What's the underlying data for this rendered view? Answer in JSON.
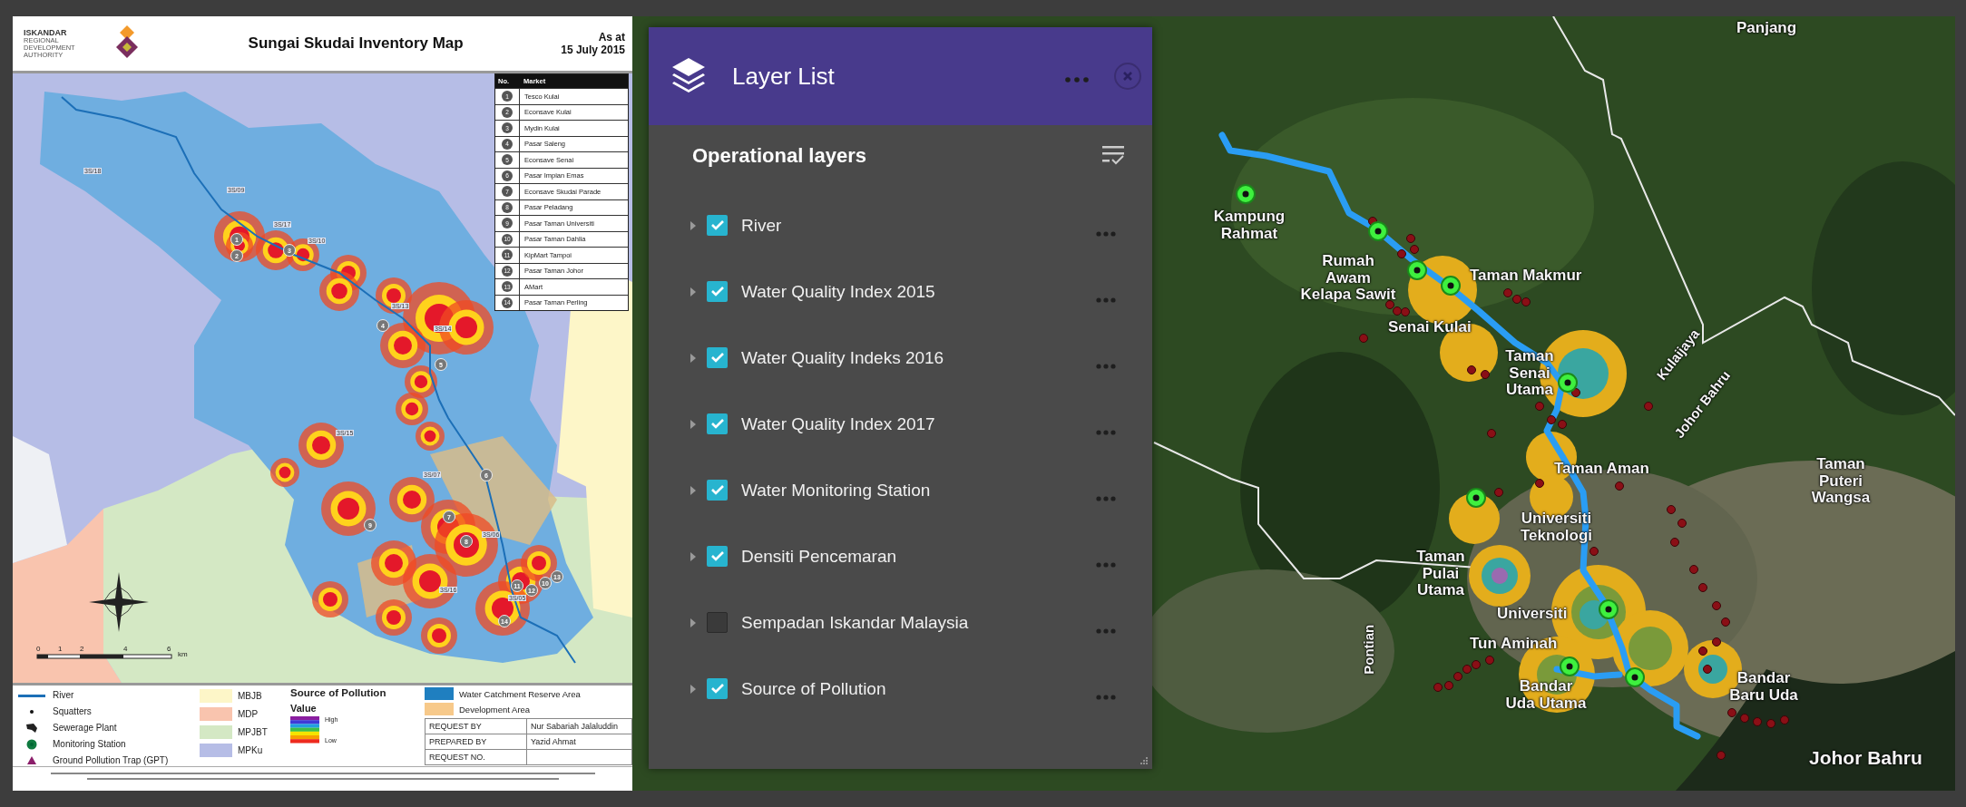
{
  "poster": {
    "logo": {
      "brand": "ISKANDAR",
      "subtitle": "REGIONAL DEVELOPMENT AUTHORITY"
    },
    "title": "Sungai Skudai Inventory Map",
    "date_lines": [
      "As at",
      "15 July 2015"
    ],
    "market_table": {
      "columns": [
        "No.",
        "Market"
      ],
      "rows": [
        {
          "no": "1",
          "market": "Tesco Kulai"
        },
        {
          "no": "2",
          "market": "Econsave Kulai"
        },
        {
          "no": "3",
          "market": "Mydin Kulai"
        },
        {
          "no": "4",
          "market": "Pasar Saleng"
        },
        {
          "no": "5",
          "market": "Econsave Senai"
        },
        {
          "no": "6",
          "market": "Pasar Impian Emas"
        },
        {
          "no": "7",
          "market": "Econsave Skudai Parade"
        },
        {
          "no": "8",
          "market": "Pasar Peladang"
        },
        {
          "no": "9",
          "market": "Pasar Taman Universiti"
        },
        {
          "no": "10",
          "market": "Pasar Taman Dahlia"
        },
        {
          "no": "11",
          "market": "KipMart Tampoi"
        },
        {
          "no": "12",
          "market": "Pasar Taman Johor"
        },
        {
          "no": "13",
          "market": "AMart"
        },
        {
          "no": "14",
          "market": "Pasar Taman Perling"
        }
      ]
    },
    "station_labels": [
      "3S/18",
      "3S/09",
      "3S/17",
      "3S/10",
      "3S/13",
      "3S/14",
      "3S/15",
      "3S/07",
      "3S/06",
      "3S/05",
      "3S/16"
    ],
    "market_markers": [
      "1",
      "2",
      "3",
      "4",
      "5",
      "6",
      "7",
      "8",
      "9",
      "10",
      "11",
      "12",
      "13",
      "14"
    ],
    "scale": {
      "ticks": [
        "0",
        "1",
        "2",
        "4",
        "6"
      ],
      "unit": "km"
    },
    "legend": {
      "symbols": [
        {
          "kind": "line",
          "label": "River"
        },
        {
          "kind": "dot",
          "label": "Squatters"
        },
        {
          "kind": "plant",
          "label": "Sewerage Plant"
        },
        {
          "kind": "station",
          "label": "Monitoring Station"
        },
        {
          "kind": "triangle",
          "label": "Ground Pollution Trap (GPT)"
        }
      ],
      "areas": [
        {
          "label": "MBJB",
          "color": "#fdf6c8"
        },
        {
          "label": "MDP",
          "color": "#f9c4ae"
        },
        {
          "label": "MPJBT",
          "color": "#d4e8c4"
        },
        {
          "label": "MPKu",
          "color": "#b6bde6"
        }
      ],
      "pollution": {
        "title": "Source of Pollution",
        "subtitle": "Value",
        "high": "High",
        "low": "Low"
      },
      "zones": [
        {
          "label": "Water Catchment Reserve Area",
          "color": "#1f7fc0"
        },
        {
          "label": "Development Area",
          "color": "#f7c98a"
        }
      ],
      "request": [
        {
          "label": "REQUEST BY",
          "value": "Nur Sabariah Jalaluddin"
        },
        {
          "label": "PREPARED BY",
          "value": "Yazid Ahmat"
        },
        {
          "label": "REQUEST NO."
        }
      ]
    }
  },
  "layer_list": {
    "title": "Layer List",
    "section": "Operational layers",
    "layers": [
      {
        "name": "River",
        "checked": true
      },
      {
        "name": "Water Quality Index 2015",
        "checked": true
      },
      {
        "name": "Water Quality Indeks 2016",
        "checked": true
      },
      {
        "name": "Water Quality Index 2017",
        "checked": true
      },
      {
        "name": "Water Monitoring Station",
        "checked": true
      },
      {
        "name": "Densiti Pencemaran",
        "checked": true
      },
      {
        "name": "Sempadan Iskandar Malaysia",
        "checked": false
      },
      {
        "name": "Source of Pollution",
        "checked": true
      }
    ]
  },
  "map": {
    "labels": [
      {
        "kind": "place",
        "text": "Panjang"
      },
      {
        "kind": "place",
        "text": "Kampung Rahmat"
      },
      {
        "kind": "place",
        "text": "Rumah Awam Kelapa Sawit"
      },
      {
        "kind": "place",
        "text": "Taman Makmur"
      },
      {
        "kind": "place",
        "text": "Senai Kulai"
      },
      {
        "kind": "place",
        "text": "Taman Senai Utama"
      },
      {
        "kind": "road",
        "text": "Kulaijaya"
      },
      {
        "kind": "road",
        "text": "Johor Bahru"
      },
      {
        "kind": "place",
        "text": "Taman Aman"
      },
      {
        "kind": "place",
        "text": "Taman Puteri Wangsa"
      },
      {
        "kind": "place",
        "text": "Universiti Teknologi"
      },
      {
        "kind": "place",
        "text": "Taman Pulai Utama"
      },
      {
        "kind": "place",
        "text": "Universiti"
      },
      {
        "kind": "place",
        "text": "Tun Aminah"
      },
      {
        "kind": "place",
        "text": "Bandar Uda Utama"
      },
      {
        "kind": "place",
        "text": "Bandar Baru Uda"
      },
      {
        "kind": "road",
        "text": "Pontian"
      },
      {
        "kind": "city",
        "text": "Johor Bahru"
      }
    ]
  }
}
